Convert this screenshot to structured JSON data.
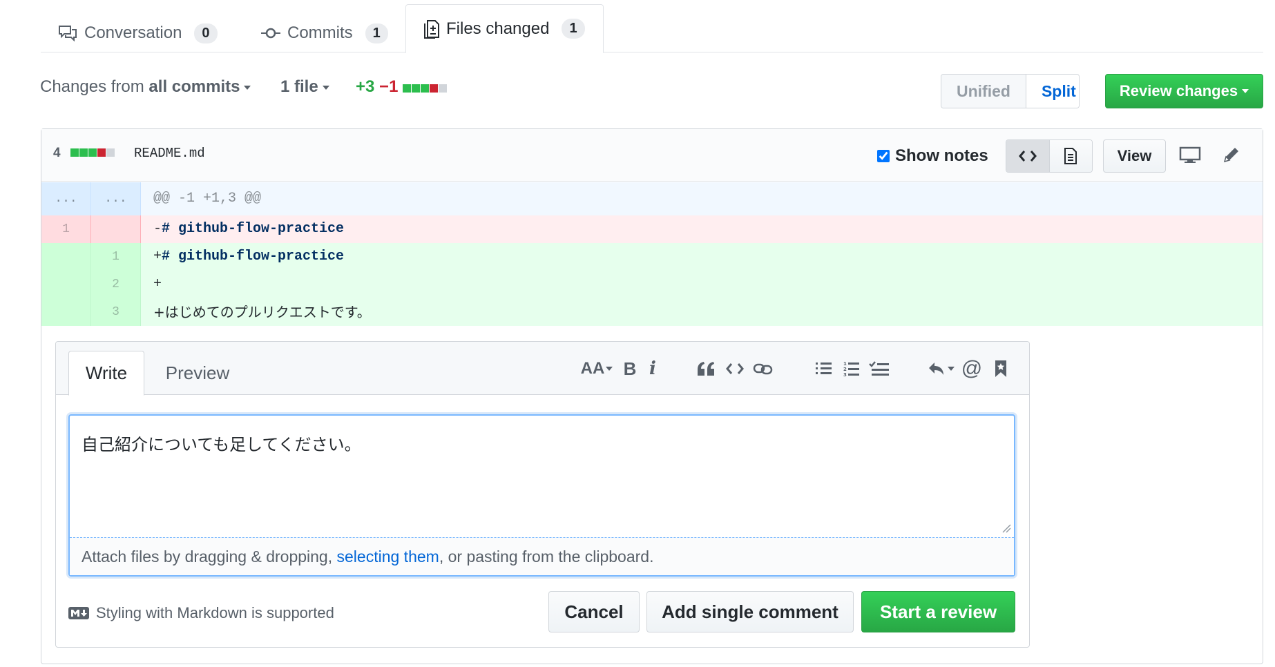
{
  "tabs": [
    {
      "label": "Conversation",
      "count": "0",
      "icon": "comment-discussion-icon"
    },
    {
      "label": "Commits",
      "count": "1",
      "icon": "git-commit-icon"
    },
    {
      "label": "Files changed",
      "count": "1",
      "icon": "diff-icon",
      "active": true
    }
  ],
  "toolbar": {
    "changes_prefix": "Changes from",
    "changes_value": "all commits",
    "files_label": "1 file",
    "additions": "+3",
    "deletions": "−1",
    "view_unified": "Unified",
    "view_split": "Split",
    "review_button": "Review changes"
  },
  "file": {
    "change_count": "4",
    "name": "README.md",
    "show_notes_label": "Show notes",
    "show_notes_checked": true,
    "view_button": "View"
  },
  "diff": {
    "hunk": {
      "left": "...",
      "right": "...",
      "text": "@@ -1 +1,3 @@"
    },
    "lines": [
      {
        "type": "del",
        "left": "1",
        "right": "",
        "prefix": "-",
        "text": "# github-flow-practice"
      },
      {
        "type": "add",
        "left": "",
        "right": "1",
        "prefix": "+",
        "text": "# github-flow-practice"
      },
      {
        "type": "add",
        "left": "",
        "right": "2",
        "prefix": "+",
        "text": ""
      },
      {
        "type": "add",
        "left": "",
        "right": "3",
        "prefix": "+",
        "text": "はじめてのプルリクエストです。"
      }
    ]
  },
  "comment": {
    "tab_write": "Write",
    "tab_preview": "Preview",
    "text": "自己紹介についても足してください。",
    "attach_prefix": "Attach files by dragging & dropping, ",
    "attach_link": "selecting them",
    "attach_suffix": ", or pasting from the clipboard.",
    "markdown_note": "Styling with Markdown is supported",
    "cancel": "Cancel",
    "single": "Add single comment",
    "start_review": "Start a review"
  },
  "colors": {
    "green": "#28a745",
    "link": "#0366d6",
    "addition": "#2cbe4e",
    "deletion": "#cb2431"
  }
}
